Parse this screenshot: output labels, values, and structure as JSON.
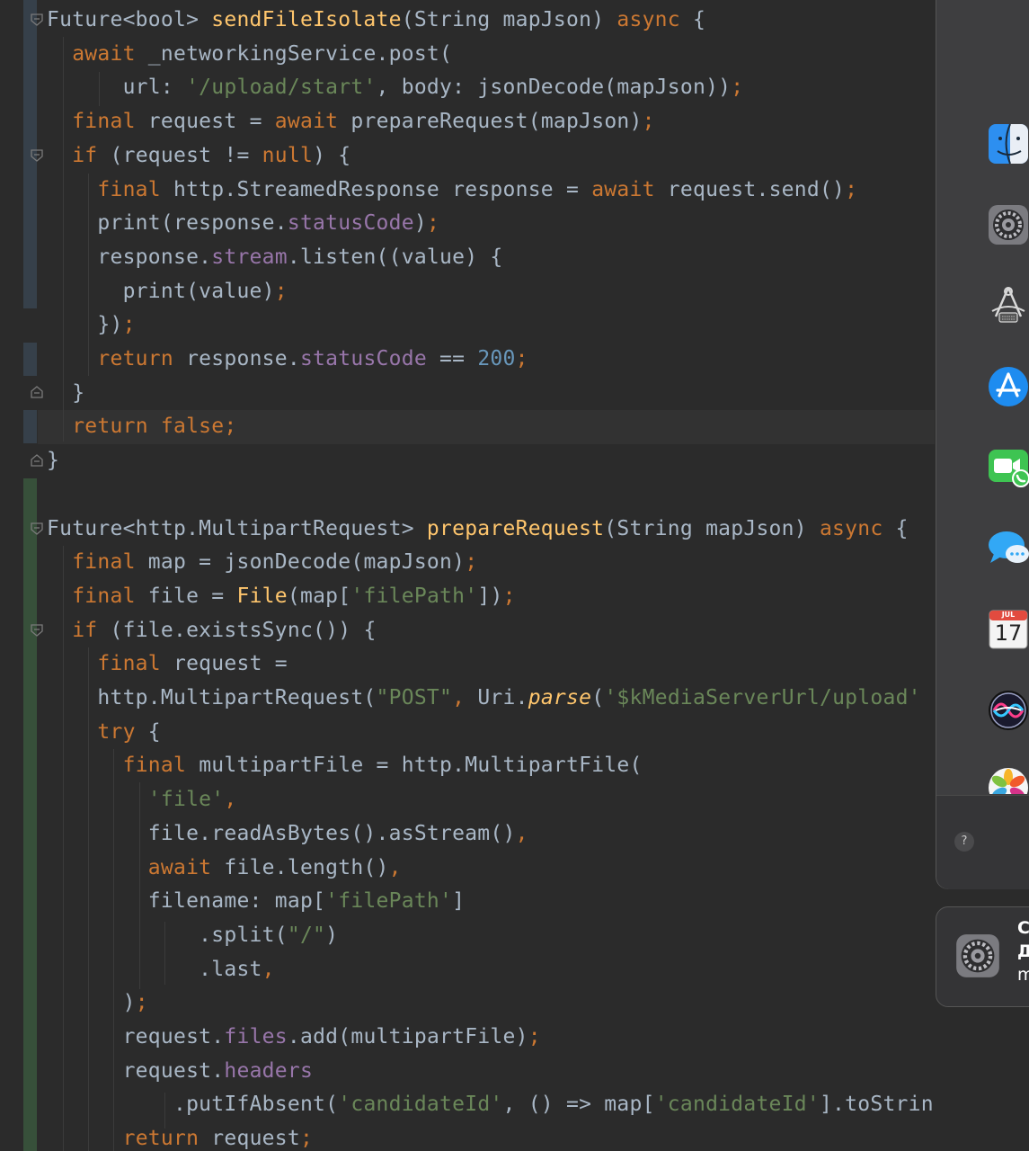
{
  "editor": {
    "lines": [
      [
        [
          "Future<bool> ",
          "plain"
        ],
        [
          "sendFileIsolate",
          "fn"
        ],
        [
          "(String mapJson) ",
          "plain"
        ],
        [
          "async ",
          "kw"
        ],
        [
          "{",
          "plain"
        ]
      ],
      [
        [
          "  ",
          "plain"
        ],
        [
          "await ",
          "kw"
        ],
        [
          "_networkingService.post(",
          "plain"
        ]
      ],
      [
        [
          "      url: ",
          "plain"
        ],
        [
          "'/upload/start'",
          "str"
        ],
        [
          ", body: jsonDecode(mapJson))",
          "plain"
        ],
        [
          ";",
          "kw"
        ]
      ],
      [
        [
          "  ",
          "plain"
        ],
        [
          "final ",
          "kw"
        ],
        [
          "request = ",
          "plain"
        ],
        [
          "await ",
          "kw"
        ],
        [
          "prepareRequest(mapJson)",
          "plain"
        ],
        [
          ";",
          "kw"
        ]
      ],
      [
        [
          "  ",
          "plain"
        ],
        [
          "if ",
          "kw"
        ],
        [
          "(request != ",
          "plain"
        ],
        [
          "null",
          "kw"
        ],
        [
          ") {",
          "plain"
        ]
      ],
      [
        [
          "    ",
          "plain"
        ],
        [
          "final ",
          "kw"
        ],
        [
          "http.StreamedResponse response = ",
          "plain"
        ],
        [
          "await ",
          "kw"
        ],
        [
          "request.send()",
          "plain"
        ],
        [
          ";",
          "kw"
        ]
      ],
      [
        [
          "    print(response.",
          "plain"
        ],
        [
          "statusCode",
          "field"
        ],
        [
          ")",
          "plain"
        ],
        [
          ";",
          "kw"
        ]
      ],
      [
        [
          "    response.",
          "plain"
        ],
        [
          "stream",
          "field"
        ],
        [
          ".listen((value) {",
          "plain"
        ]
      ],
      [
        [
          "      print(value)",
          "plain"
        ],
        [
          ";",
          "kw"
        ]
      ],
      [
        [
          "    })",
          "plain"
        ],
        [
          ";",
          "kw"
        ]
      ],
      [
        [
          "    ",
          "plain"
        ],
        [
          "return ",
          "kw"
        ],
        [
          "response.",
          "plain"
        ],
        [
          "statusCode ",
          "field"
        ],
        [
          "== ",
          "plain"
        ],
        [
          "200",
          "num"
        ],
        [
          ";",
          "kw"
        ]
      ],
      [
        [
          "  }",
          "plain"
        ]
      ],
      [
        [
          "  ",
          "plain"
        ],
        [
          "return false;",
          "kw"
        ]
      ],
      [
        [
          "}",
          "plain"
        ]
      ],
      [
        [
          "",
          "plain"
        ]
      ],
      [
        [
          "Future<http.MultipartRequest> ",
          "plain"
        ],
        [
          "prepareRequest",
          "fn"
        ],
        [
          "(String mapJson) ",
          "plain"
        ],
        [
          "async ",
          "kw"
        ],
        [
          "{",
          "plain"
        ]
      ],
      [
        [
          "  ",
          "plain"
        ],
        [
          "final ",
          "kw"
        ],
        [
          "map = jsonDecode(mapJson)",
          "plain"
        ],
        [
          ";",
          "kw"
        ]
      ],
      [
        [
          "  ",
          "plain"
        ],
        [
          "final ",
          "kw"
        ],
        [
          "file = ",
          "plain"
        ],
        [
          "File",
          "cls"
        ],
        [
          "(map[",
          "plain"
        ],
        [
          "'filePath'",
          "str"
        ],
        [
          "])",
          "plain"
        ],
        [
          ";",
          "kw"
        ]
      ],
      [
        [
          "  ",
          "plain"
        ],
        [
          "if ",
          "kw"
        ],
        [
          "(file.existsSync()) {",
          "plain"
        ]
      ],
      [
        [
          "    ",
          "plain"
        ],
        [
          "final ",
          "kw"
        ],
        [
          "request =",
          "plain"
        ]
      ],
      [
        [
          "    http.MultipartRequest(",
          "plain"
        ],
        [
          "\"POST\"",
          "str"
        ],
        [
          ", ",
          "kw"
        ],
        [
          "Uri.",
          "plain"
        ],
        [
          "parse",
          "it"
        ],
        [
          "(",
          "plain"
        ],
        [
          "'$kMediaServerUrl/upload'",
          "str"
        ]
      ],
      [
        [
          "    ",
          "plain"
        ],
        [
          "try ",
          "kw"
        ],
        [
          "{",
          "plain"
        ]
      ],
      [
        [
          "      ",
          "plain"
        ],
        [
          "final ",
          "kw"
        ],
        [
          "multipartFile = http.MultipartFile(",
          "plain"
        ]
      ],
      [
        [
          "        ",
          "plain"
        ],
        [
          "'file'",
          "str"
        ],
        [
          ",",
          "kw"
        ]
      ],
      [
        [
          "        file.readAsBytes().asStream()",
          "plain"
        ],
        [
          ",",
          "kw"
        ]
      ],
      [
        [
          "        ",
          "plain"
        ],
        [
          "await ",
          "kw"
        ],
        [
          "file.length()",
          "plain"
        ],
        [
          ",",
          "kw"
        ]
      ],
      [
        [
          "        filename: map[",
          "plain"
        ],
        [
          "'filePath'",
          "str"
        ],
        [
          "]",
          "plain"
        ]
      ],
      [
        [
          "            .split(",
          "plain"
        ],
        [
          "\"/\"",
          "str"
        ],
        [
          ")",
          "plain"
        ]
      ],
      [
        [
          "            .last",
          "plain"
        ],
        [
          ",",
          "kw"
        ]
      ],
      [
        [
          "      )",
          "plain"
        ],
        [
          ";",
          "kw"
        ]
      ],
      [
        [
          "      request.",
          "plain"
        ],
        [
          "files",
          "field"
        ],
        [
          ".add(multipartFile)",
          "plain"
        ],
        [
          ";",
          "kw"
        ]
      ],
      [
        [
          "      request.",
          "plain"
        ],
        [
          "headers",
          "field"
        ]
      ],
      [
        [
          "          .putIfAbsent(",
          "plain"
        ],
        [
          "'candidateId'",
          "str"
        ],
        [
          ", () => map[",
          "plain"
        ],
        [
          "'candidateId'",
          "str"
        ],
        [
          "].toString())",
          "plain"
        ],
        [
          ";",
          "kw"
        ]
      ],
      [
        [
          "      ",
          "plain"
        ],
        [
          "return ",
          "kw"
        ],
        [
          "request",
          "plain"
        ],
        [
          ";",
          "kw"
        ]
      ]
    ]
  },
  "dock": {
    "icons": [
      "finder-icon",
      "system-preferences-icon",
      "script-editor-icon",
      "app-store-icon",
      "facetime-icon",
      "messages-icon",
      "calendar-icon",
      "siri-icon",
      "photos-icon"
    ],
    "calendar": {
      "month": "JUL",
      "day": "17"
    },
    "help_label": "?"
  },
  "notification": {
    "lines": [
      "С",
      "Д",
      "m"
    ]
  },
  "colors": {
    "background": "#2b2b2b",
    "keyword": "#cc7832",
    "function": "#ffc66d",
    "string": "#6a8759",
    "number": "#6897bb",
    "field": "#9876aa",
    "text": "#a9b7c6"
  }
}
